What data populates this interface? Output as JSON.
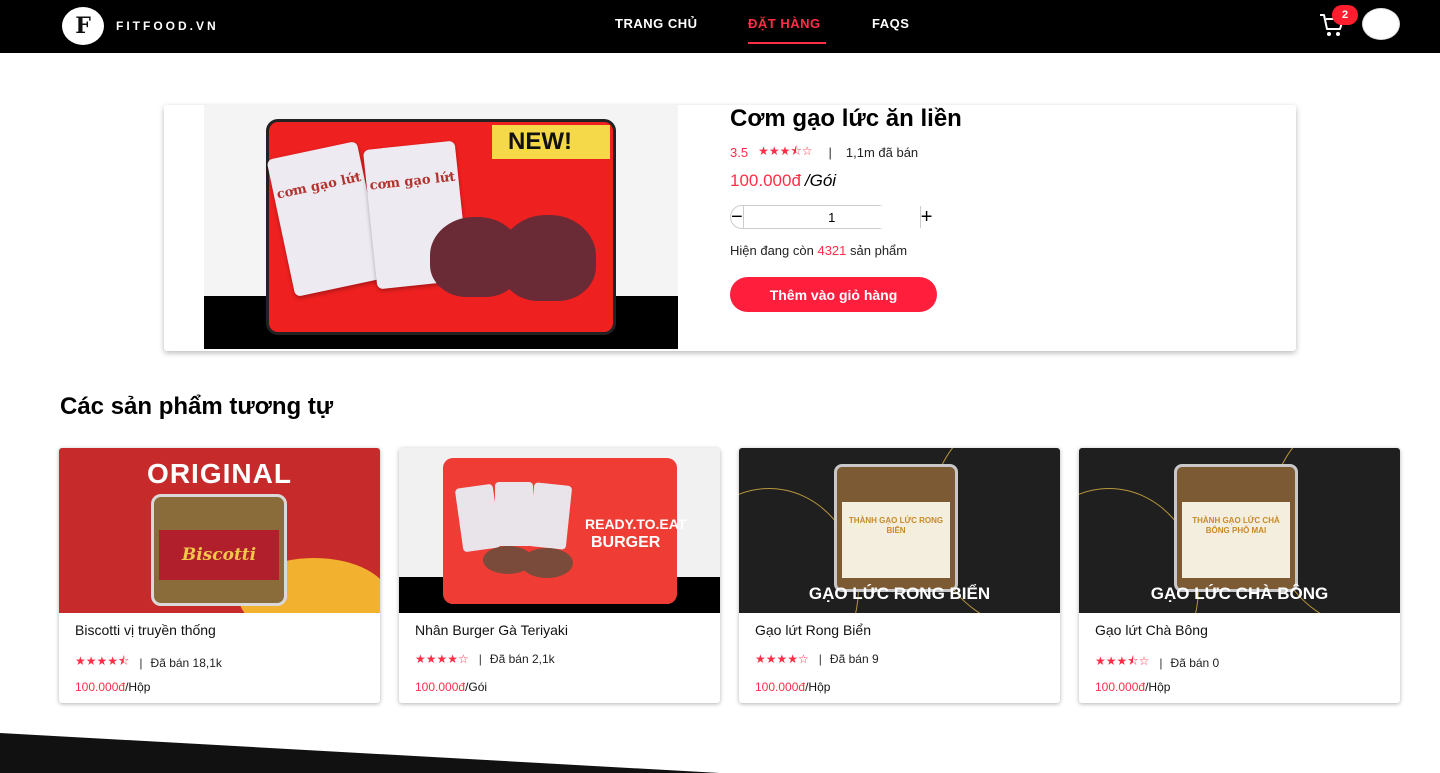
{
  "header": {
    "logo_text": "FITFOOD.VN",
    "logo_letter": "F",
    "nav": [
      {
        "label": "TRANG CHỦ",
        "active": false
      },
      {
        "label": "ĐẶT HÀNG",
        "active": true
      },
      {
        "label": "FAQS",
        "active": false
      }
    ],
    "cart_count": "2"
  },
  "product": {
    "title": "Cơm gạo lức ăn liền",
    "rating": "3.5",
    "stars": "★★★⯪☆",
    "sold": "1,1m đã bán",
    "price": "100.000đ",
    "unit": "/Gói",
    "quantity": "1",
    "stock_prefix": "Hiện đang còn",
    "stock_count": "4321",
    "stock_suffix": "sản phẩm",
    "add_to_cart": "Thêm vào giỏ hàng",
    "image": {
      "badge": "NEW!",
      "pack_text": "cơm gạo lứt"
    }
  },
  "similar": {
    "title": "Các sản phẩm tương tự",
    "items": [
      {
        "name": "Biscotti vị truyền thống",
        "stars": "★★★★⯪",
        "sold": "Đã bán 18,1k",
        "price": "100.000đ",
        "unit": "/Hộp",
        "image_title": "ORIGINAL",
        "image_label": "Biscotti"
      },
      {
        "name": "Nhân Burger Gà Teriyaki",
        "stars": "★★★★☆",
        "sold": "Đã bán 2,1k",
        "price": "100.000đ",
        "unit": "/Gói",
        "image_title": "READY.TO.EAT",
        "image_label": "BURGER"
      },
      {
        "name": "Gạo lứt Rong Biển",
        "stars": "★★★★☆",
        "sold": "Đã bán 9",
        "price": "100.000đ",
        "unit": "/Hộp",
        "image_title": "GẠO LỨC RONG BIỂN",
        "image_label": "THÀNH GẠO LỨC RONG BIỂN"
      },
      {
        "name": "Gạo lứt Chà Bông",
        "stars": "★★★⯪☆",
        "sold": "Đã bán 0",
        "price": "100.000đ",
        "unit": "/Hộp",
        "image_title": "GẠO LỨC CHÀ BÔNG",
        "image_label": "THÀNH GẠO LỨC CHÀ BÔNG PHÔ MAI"
      }
    ]
  },
  "colors": {
    "accent": "#ff2e46",
    "header_bg": "#000000"
  }
}
